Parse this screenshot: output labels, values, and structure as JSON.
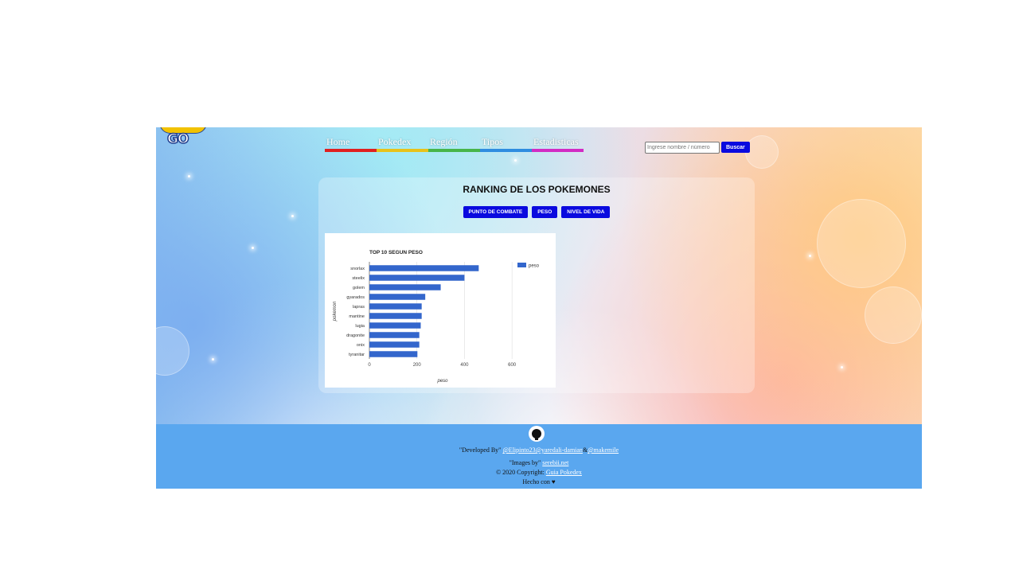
{
  "colors": {
    "button": "#0a0adf",
    "footer": "#5aa7ef",
    "bar": "#3366cc"
  },
  "logo": {
    "text": "GO"
  },
  "nav": {
    "items": [
      {
        "label": "Home",
        "color": "#e02020"
      },
      {
        "label": "Pokedex",
        "color": "#e8c21a"
      },
      {
        "label": "Región",
        "color": "#47b54a"
      },
      {
        "label": "Tipos",
        "color": "#2f8de0"
      },
      {
        "label": "Estadisticas",
        "color": "#d22cc4"
      }
    ]
  },
  "search": {
    "placeholder": "Ingrese nombre / número",
    "button_label": "Buscar"
  },
  "ranking": {
    "title": "RANKING DE LOS POKEMONES",
    "buttons": [
      "PUNTO DE COMBATE",
      "PESO",
      "NIVEL DE VIDA"
    ]
  },
  "chart_data": {
    "type": "bar",
    "orientation": "horizontal",
    "title": "TOP 10 SEGUN PESO",
    "xlabel": "peso",
    "ylabel": "pokemon",
    "categories": [
      "snorlax",
      "steelix",
      "golem",
      "gyarados",
      "lapras",
      "mantine",
      "lugia",
      "dragonite",
      "onix",
      "tyranitar"
    ],
    "series": [
      {
        "name": "peso",
        "values": [
          460,
          400,
          300,
          235,
          220,
          220,
          216,
          210,
          210,
          202
        ]
      }
    ],
    "xlim": [
      0,
      700
    ],
    "xticks": [
      0,
      200,
      400,
      600
    ],
    "grid": true,
    "legend": "right"
  },
  "footer": {
    "developed_prefix": "\"Developed By\"",
    "dev1": "@Elipinto23",
    "dev2": "@yaredali-damian",
    "sep": "&",
    "dev3": "@makemile",
    "images_prefix": "\"Images by\"",
    "images_link": "serebii.net",
    "copyright_prefix": "© 2020 Copyright:",
    "copyright_link": "Guia Pokedex",
    "made_with": "Hecho con ♥"
  }
}
